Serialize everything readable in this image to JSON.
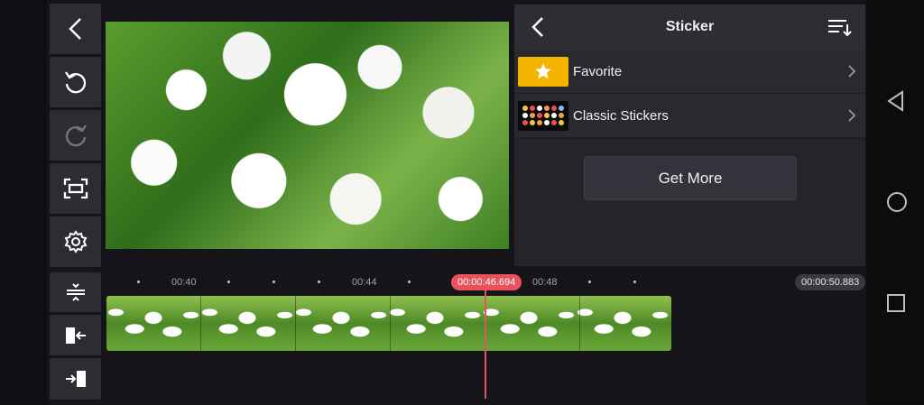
{
  "toolbar": {
    "buttons": [
      {
        "name": "back-icon",
        "enabled": true
      },
      {
        "name": "undo-icon",
        "enabled": true
      },
      {
        "name": "redo-icon",
        "enabled": false
      },
      {
        "name": "fit-screen-icon",
        "enabled": true
      },
      {
        "name": "settings-icon",
        "enabled": true
      },
      {
        "name": "adjust-icon",
        "enabled": true
      },
      {
        "name": "trim-end-icon",
        "enabled": true
      },
      {
        "name": "trim-start-icon",
        "enabled": true
      }
    ]
  },
  "panel": {
    "title": "Sticker",
    "back_icon": "back-icon",
    "sort_icon": "sort-icon",
    "items": [
      {
        "label": "Favorite",
        "thumb_icon": "star-icon",
        "thumb_color": "#f4b400"
      },
      {
        "label": "Classic Stickers",
        "thumb_icon": "sticker-grid-icon",
        "thumb_color": "#0b0b0b"
      }
    ],
    "get_more_label": "Get More"
  },
  "timeline": {
    "ruler_labels": [
      "00:40",
      "00:44",
      "00:48"
    ],
    "current_time": "00:00:46.694",
    "total_time": "00:00:50.883",
    "playhead_color": "#e8525c"
  },
  "system_nav": {
    "buttons": [
      "back-triangle-icon",
      "home-circle-icon",
      "recents-square-icon"
    ]
  },
  "colors": {
    "accent_red": "#e8525c",
    "star_yellow": "#f4b400",
    "panel_bg": "#252429"
  }
}
